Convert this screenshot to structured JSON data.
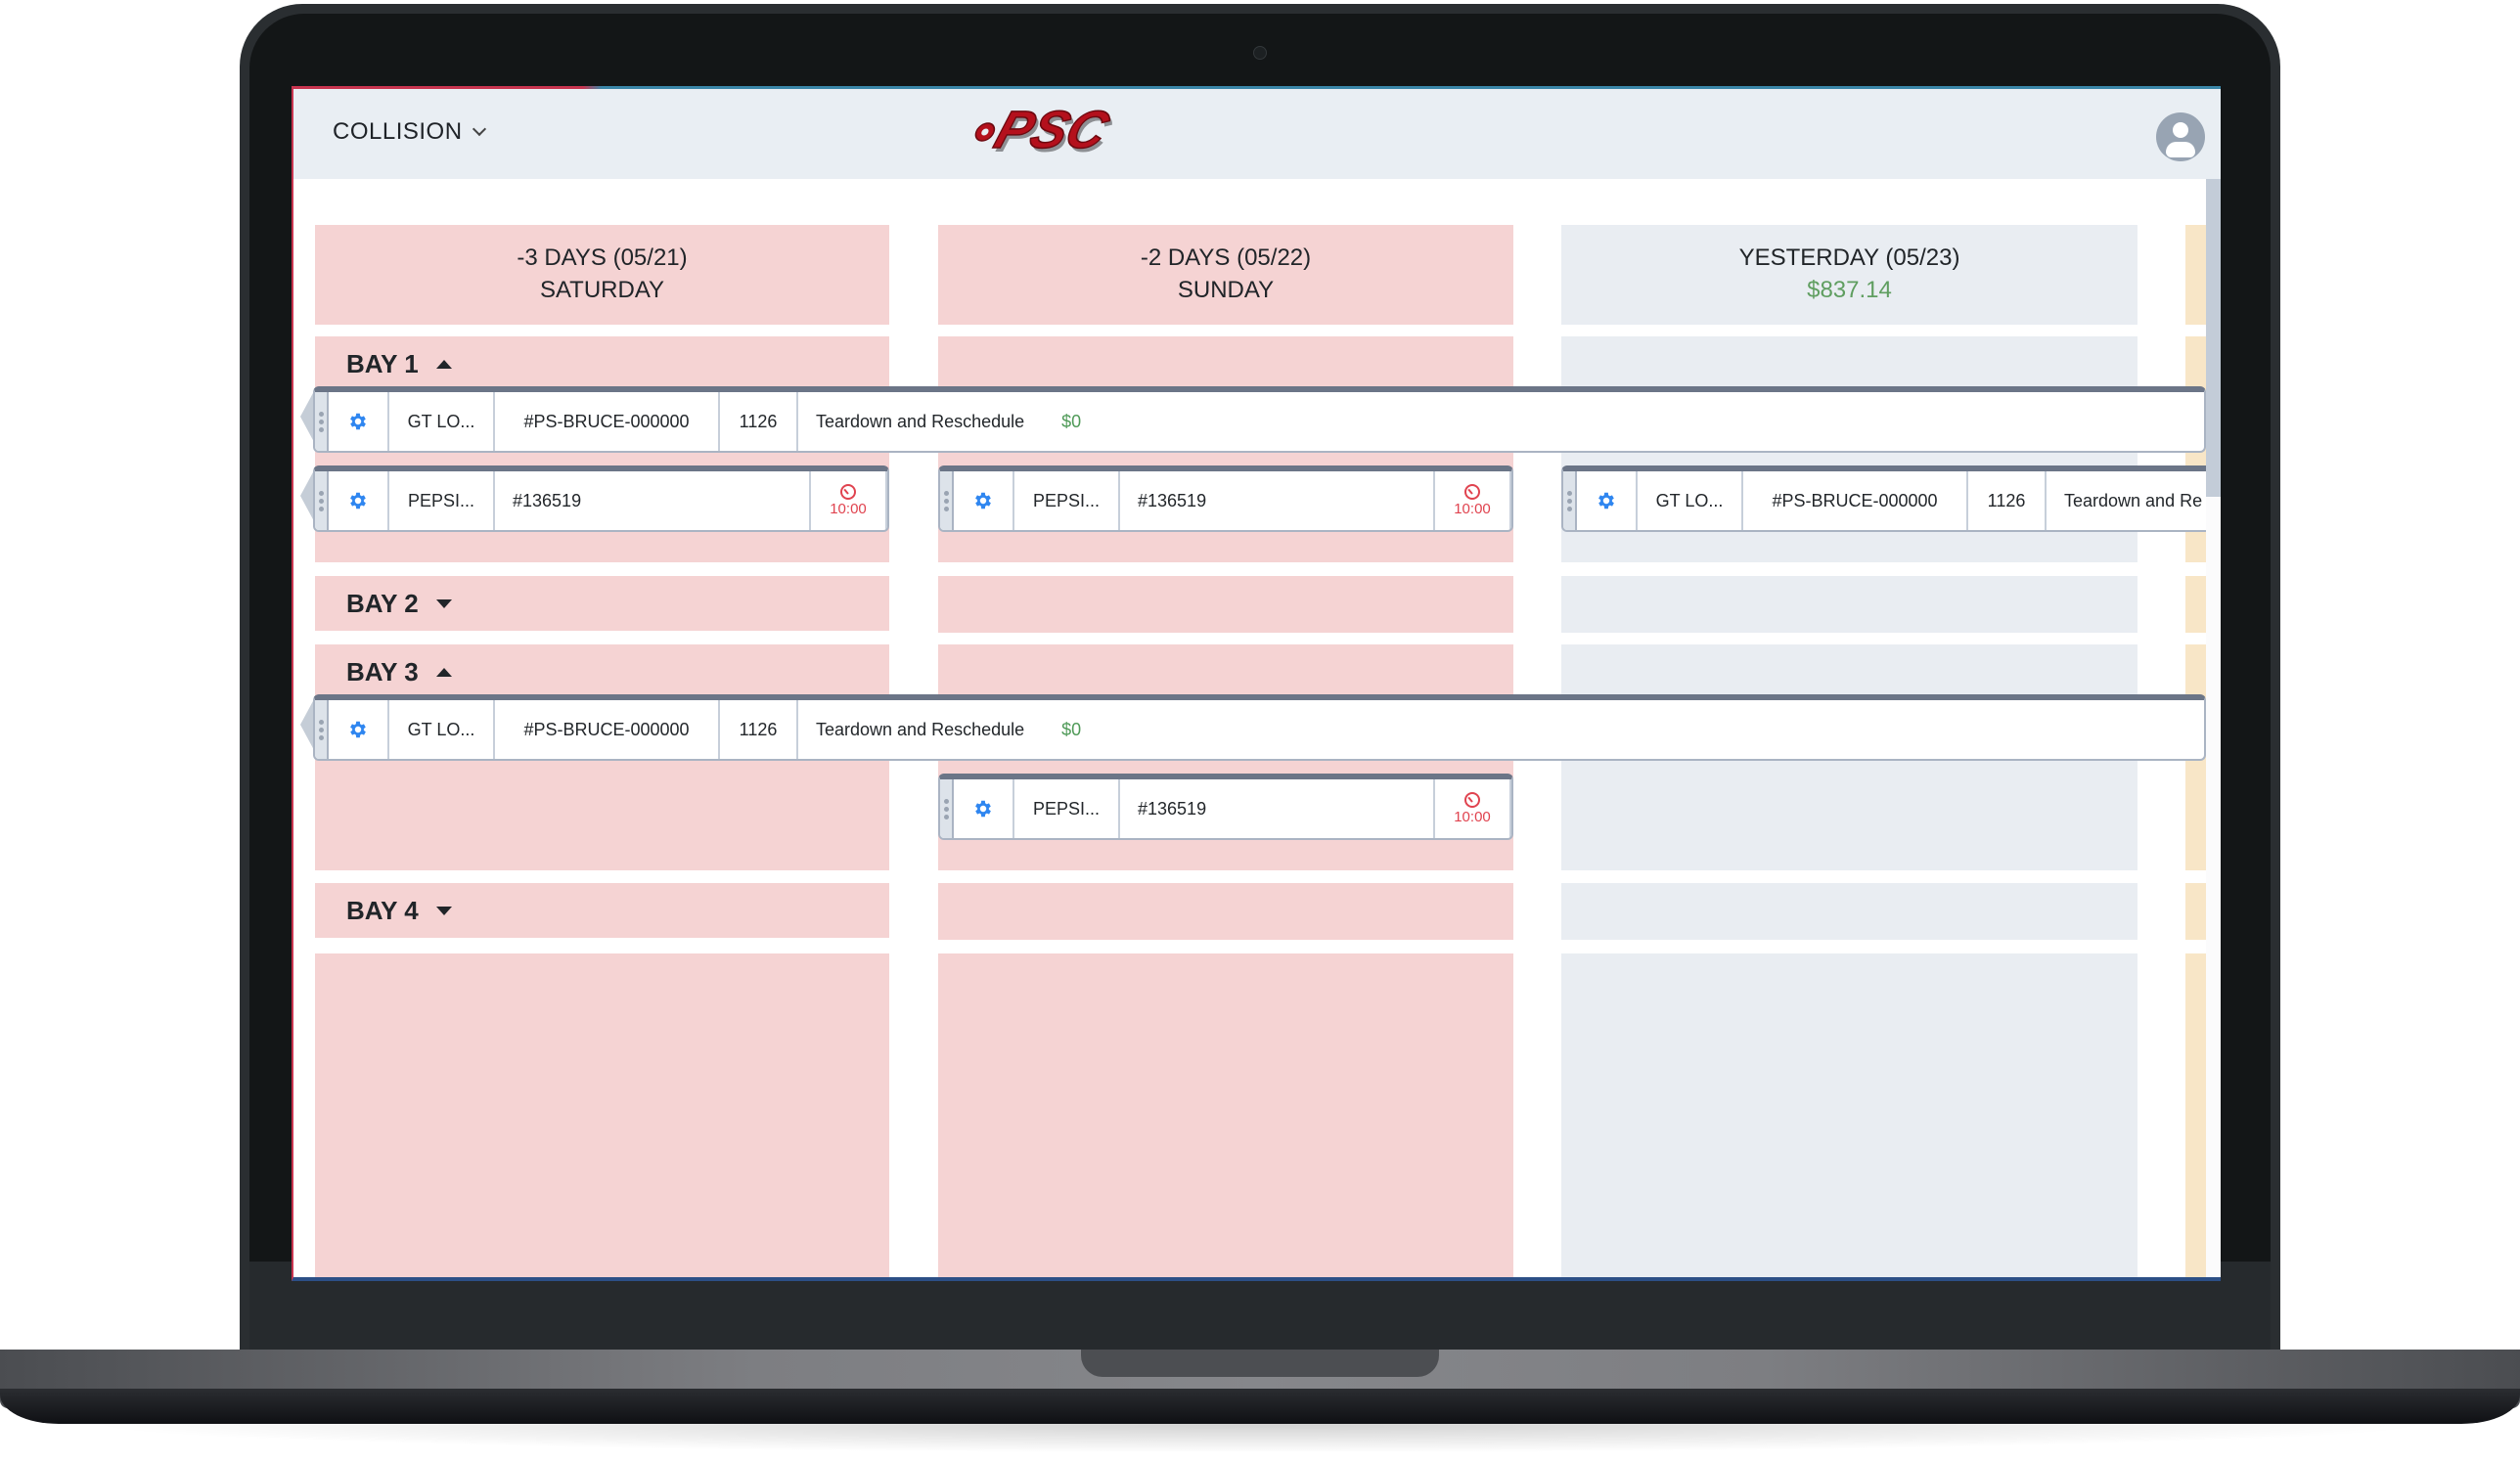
{
  "header": {
    "module": "COLLISION",
    "logo_text": "PSC",
    "avatar_icon": "user-avatar-icon"
  },
  "columns": [
    {
      "title": "-3 DAYS (05/21)",
      "subtitle": "SATURDAY",
      "status": "past-overdue",
      "color": "#f5d3d3"
    },
    {
      "title": "-2 DAYS (05/22)",
      "subtitle": "SUNDAY",
      "status": "past-overdue",
      "color": "#f5d3d3"
    },
    {
      "title": "YESTERDAY (05/23)",
      "subtitle": "$837.14",
      "status": "past",
      "color": "#e9edf2"
    },
    {
      "title": "",
      "subtitle": "",
      "status": "today",
      "color": "#f8e6c7"
    }
  ],
  "bays": [
    {
      "label": "BAY 1",
      "expanded": true
    },
    {
      "label": "BAY 2",
      "expanded": false
    },
    {
      "label": "BAY 3",
      "expanded": true
    },
    {
      "label": "BAY 4",
      "expanded": false
    }
  ],
  "jobs": {
    "gt_long": {
      "customer": "GT LO...",
      "ro": "#PS-BRUCE-000000",
      "number": "1126",
      "status": "Teardown and Reschedule",
      "status_truncated": "Teardown and Re",
      "amount": "$0"
    },
    "pepsi": {
      "customer": "PEPSI...",
      "ro": "#136519",
      "time": "10:00"
    }
  },
  "colors": {
    "overdue": "#f5d3d3",
    "past": "#e9edf2",
    "today": "#f8e6c7",
    "money": "#5f9e60",
    "time_alert": "#e0434f",
    "gear": "#2f86f0"
  }
}
